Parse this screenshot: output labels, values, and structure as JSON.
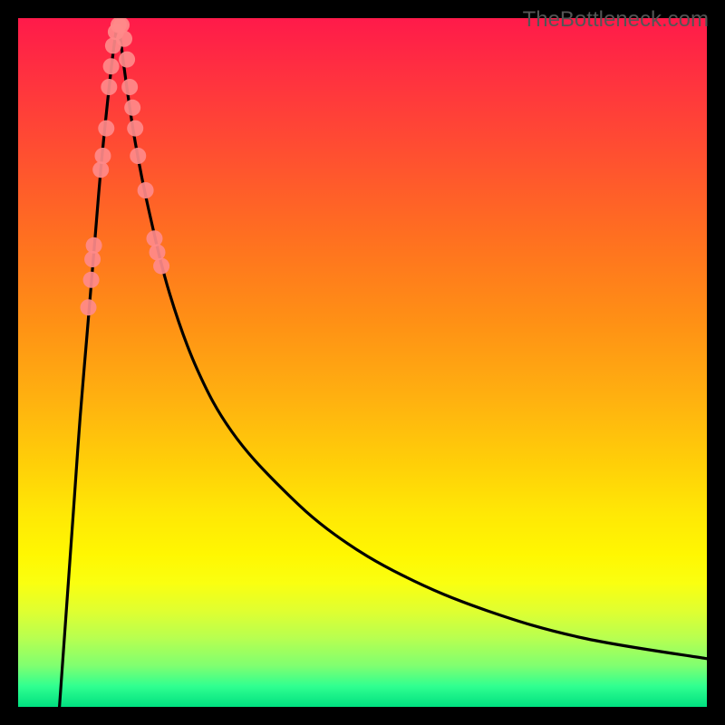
{
  "watermark_text": "TheBottleneck.com",
  "chart_data": {
    "type": "line",
    "title": "",
    "xlabel": "",
    "ylabel": "",
    "xlim": [
      0,
      100
    ],
    "ylim": [
      0,
      100
    ],
    "grid": false,
    "legend": false,
    "background_gradient": {
      "stops": [
        {
          "pos": 0,
          "color": "#ff1a4a"
        },
        {
          "pos": 50,
          "color": "#ffc010"
        },
        {
          "pos": 80,
          "color": "#fff702"
        },
        {
          "pos": 100,
          "color": "#00e080"
        }
      ]
    },
    "series": [
      {
        "name": "left-branch",
        "color": "#000000",
        "x": [
          6,
          7,
          8,
          9,
          10,
          11,
          12,
          13,
          13.8,
          14.5
        ],
        "y": [
          0,
          14,
          28,
          42,
          54,
          66,
          78,
          88,
          95,
          100
        ]
      },
      {
        "name": "right-branch",
        "color": "#000000",
        "x": [
          14.5,
          15.5,
          17,
          19,
          22,
          26,
          31,
          38,
          46,
          56,
          68,
          82,
          100
        ],
        "y": [
          100,
          92,
          82,
          72,
          60,
          49,
          40,
          32,
          25,
          19,
          14,
          10,
          7
        ]
      }
    ],
    "scatter": [
      {
        "name": "data-points",
        "color": "#ff8a8a",
        "radius": 9,
        "points": [
          {
            "x": 10.2,
            "y": 58
          },
          {
            "x": 10.6,
            "y": 62
          },
          {
            "x": 10.8,
            "y": 65
          },
          {
            "x": 11.0,
            "y": 67
          },
          {
            "x": 12.0,
            "y": 78
          },
          {
            "x": 12.3,
            "y": 80
          },
          {
            "x": 12.8,
            "y": 84
          },
          {
            "x": 13.2,
            "y": 90
          },
          {
            "x": 13.5,
            "y": 93
          },
          {
            "x": 13.8,
            "y": 96
          },
          {
            "x": 14.2,
            "y": 98
          },
          {
            "x": 14.6,
            "y": 99
          },
          {
            "x": 15.0,
            "y": 99
          },
          {
            "x": 15.4,
            "y": 97
          },
          {
            "x": 15.8,
            "y": 94
          },
          {
            "x": 16.2,
            "y": 90
          },
          {
            "x": 16.6,
            "y": 87
          },
          {
            "x": 17.0,
            "y": 84
          },
          {
            "x": 17.4,
            "y": 80
          },
          {
            "x": 18.5,
            "y": 75
          },
          {
            "x": 19.8,
            "y": 68
          },
          {
            "x": 20.2,
            "y": 66
          },
          {
            "x": 20.8,
            "y": 64
          }
        ]
      }
    ]
  }
}
